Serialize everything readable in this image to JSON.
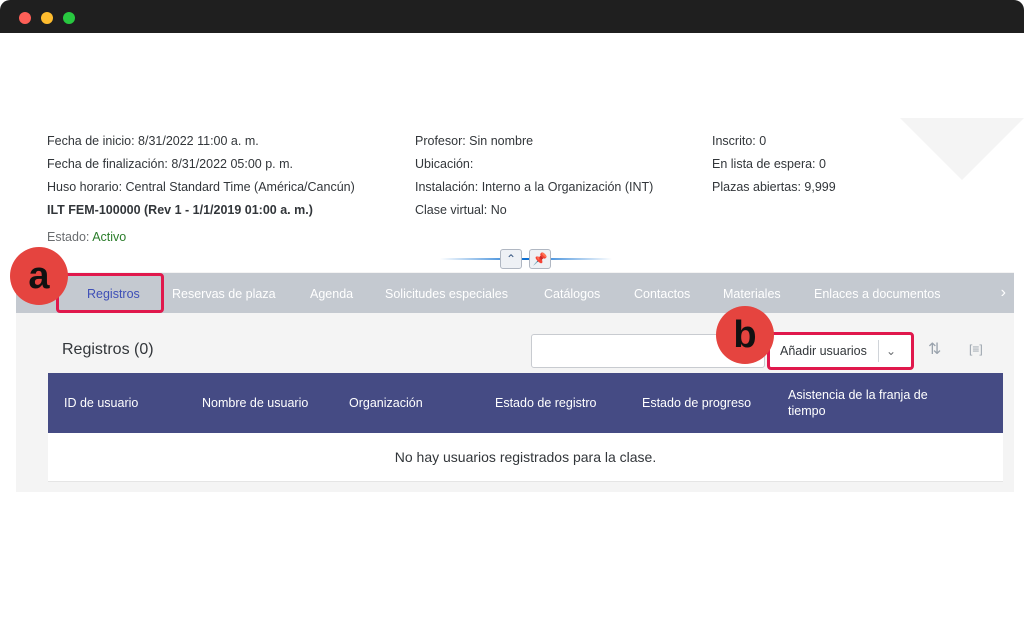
{
  "window": {
    "controls": [
      "close",
      "minimize",
      "maximize"
    ]
  },
  "info": {
    "col1": [
      "Fecha de inicio: 8/31/2022 11:00 a. m.",
      "Fecha de finalización: 8/31/2022 05:00 p. m.",
      "Huso horario: Central Standard Time (América/Cancún)",
      "ILT FEM-100000 (Rev 1 - 1/1/2019 01:00 a. m.)"
    ],
    "col2": [
      "Profesor: Sin nombre",
      "Ubicación:",
      "Instalación: Interno a la Organización (INT)",
      "Clase virtual: No"
    ],
    "col3": [
      "Inscrito: 0",
      "En lista de espera: 0",
      "Plazas abiertas: 9,999"
    ],
    "estado_label": "Estado:",
    "estado_value": "Activo"
  },
  "tabs": [
    "Registros",
    "Reservas de plaza",
    "Agenda",
    "Solicitudes especiales",
    "Catálogos",
    "Contactos",
    "Materiales",
    "Enlaces a documentos"
  ],
  "selected_tab": "Registros",
  "callouts": {
    "a": "a",
    "b": "b"
  },
  "section": {
    "title": "Registros (0)",
    "search_placeholder": "",
    "add_button": "Añadir usuarios"
  },
  "table": {
    "headers": [
      "ID de usuario",
      "Nombre de usuario",
      "Organización",
      "Estado de registro",
      "Estado de progreso",
      "Asistencia de la franja de tiempo"
    ],
    "empty_message": "No hay usuarios registrados para la clase."
  },
  "icons": {
    "collapse": "chevron-up-icon",
    "pin": "pin-icon",
    "next": "chevron-right-icon",
    "sort": "sort-icon",
    "columns": "column-settings-icon",
    "dropdown": "chevron-down-icon"
  },
  "colors": {
    "highlight": "#e0184c",
    "badge": "#e5443f",
    "table_header": "#454b84",
    "selected_tab": "#3e4fb7",
    "active": "#2b7d2b"
  }
}
